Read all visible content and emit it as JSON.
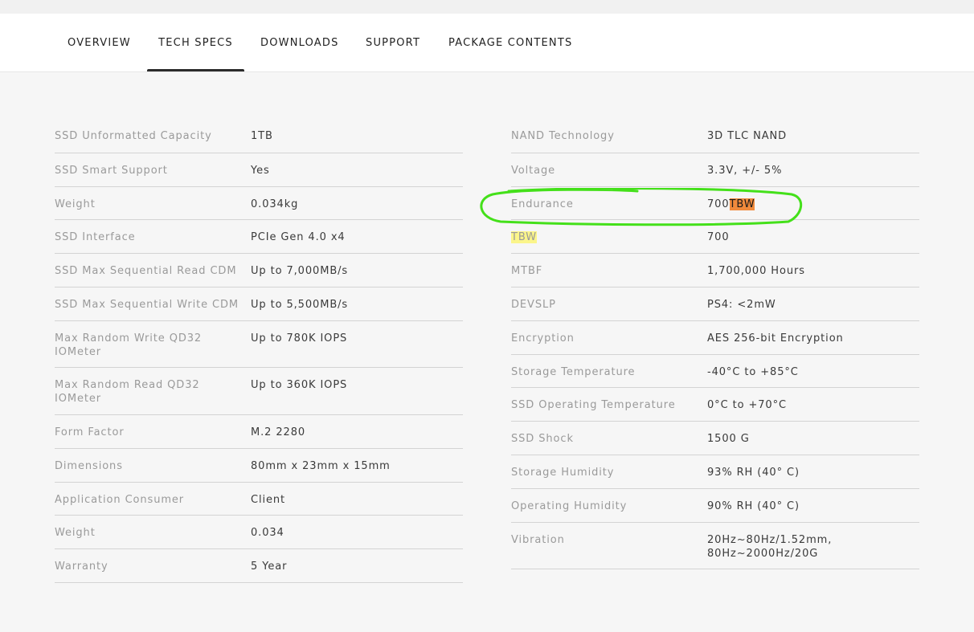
{
  "tabs": [
    {
      "label": "OVERVIEW",
      "active": false
    },
    {
      "label": "TECH SPECS",
      "active": true
    },
    {
      "label": "DOWNLOADS",
      "active": false
    },
    {
      "label": "SUPPORT",
      "active": false
    },
    {
      "label": "PACKAGE CONTENTS",
      "active": false
    }
  ],
  "left_specs": [
    {
      "label": "SSD Unformatted Capacity",
      "value": "1TB"
    },
    {
      "label": "SSD Smart Support",
      "value": "Yes"
    },
    {
      "label": "Weight",
      "value": "0.034kg"
    },
    {
      "label": "SSD Interface",
      "value": "PCIe Gen 4.0 x4"
    },
    {
      "label": "SSD Max Sequential Read CDM",
      "value": "Up to 7,000MB/s"
    },
    {
      "label": "SSD Max Sequential Write CDM",
      "value": "Up to 5,500MB/s"
    },
    {
      "label": "Max Random Write QD32 IOMeter",
      "value": "Up to 780K IOPS"
    },
    {
      "label": "Max Random Read QD32 IOMeter",
      "value": "Up to 360K IOPS"
    },
    {
      "label": "Form Factor",
      "value": "M.2 2280"
    },
    {
      "label": "Dimensions",
      "value": "80mm x 23mm x 15mm"
    },
    {
      "label": "Application Consumer",
      "value": "Client"
    },
    {
      "label": "Weight",
      "value": "0.034"
    },
    {
      "label": "Warranty",
      "value": "5 Year"
    }
  ],
  "right_specs": [
    {
      "label": "NAND Technology",
      "value": "3D TLC NAND"
    },
    {
      "label": "Voltage",
      "value": "3.3V, +/- 5%"
    },
    {
      "label": "Endurance",
      "value": "700",
      "value_suffix": "TBW"
    },
    {
      "label": "TBW",
      "value": "700"
    },
    {
      "label": "MTBF",
      "value": "1,700,000 Hours"
    },
    {
      "label": "DEVSLP",
      "value": "PS4: <2mW"
    },
    {
      "label": "Encryption",
      "value": "AES 256-bit Encryption"
    },
    {
      "label": "Storage Temperature",
      "value": "-40°C to +85°C"
    },
    {
      "label": "SSD Operating Temperature",
      "value": "0°C to +70°C"
    },
    {
      "label": "SSD Shock",
      "value": "1500 G"
    },
    {
      "label": "Storage Humidity",
      "value": "93% RH (40° C)"
    },
    {
      "label": "Operating Humidity",
      "value": "90% RH (40° C)"
    },
    {
      "label": "Vibration",
      "value": "20Hz~80Hz/1.52mm, 80Hz~2000Hz/20G"
    }
  ],
  "colors": {
    "annotation_circle": "#44e01a",
    "highlight_yellow": "#fbf58a",
    "highlight_orange": "#f08a3c",
    "active_tab_underline": "#2b2b2b"
  }
}
